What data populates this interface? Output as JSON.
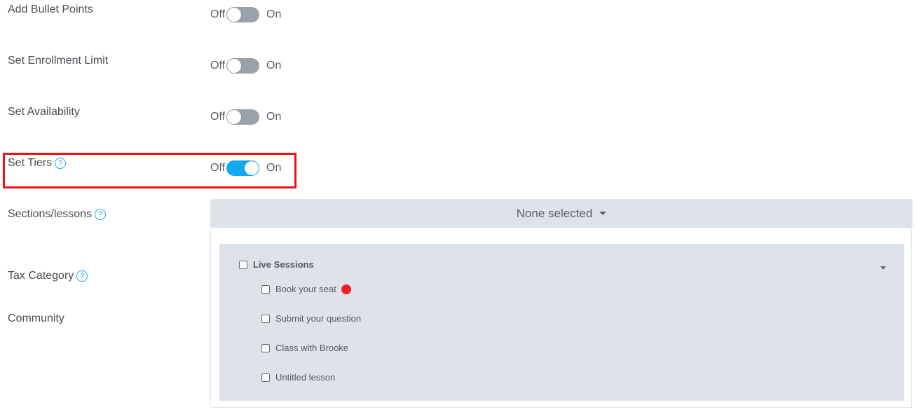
{
  "settings": [
    {
      "label": "Add Bullet Points",
      "off": "Off",
      "on": "On",
      "enabled": false
    },
    {
      "label": "Set Enrollment Limit",
      "off": "Off",
      "on": "On",
      "enabled": false
    },
    {
      "label": "Set Availability",
      "off": "Off",
      "on": "On",
      "enabled": false
    },
    {
      "label": "Set Tiers",
      "off": "Off",
      "on": "On",
      "enabled": true,
      "help": "?"
    }
  ],
  "sections": {
    "label": "Sections/lessons",
    "help": "?",
    "dropdown_value": "None selected",
    "group": {
      "title": "Live Sessions",
      "items": [
        {
          "label": "Book your seat",
          "badge_color": "#f2222a"
        },
        {
          "label": "Submit your question"
        },
        {
          "label": "Class with Brooke"
        },
        {
          "label": "Untitled lesson"
        }
      ]
    }
  },
  "tax": {
    "label": "Tax Category",
    "help": "?"
  },
  "community": {
    "label": "Community"
  },
  "colors": {
    "toggle_on": "#12a9ef",
    "toggle_off": "#9aa1a8",
    "highlight": "#e8141a",
    "help": "#1aa6e8"
  }
}
